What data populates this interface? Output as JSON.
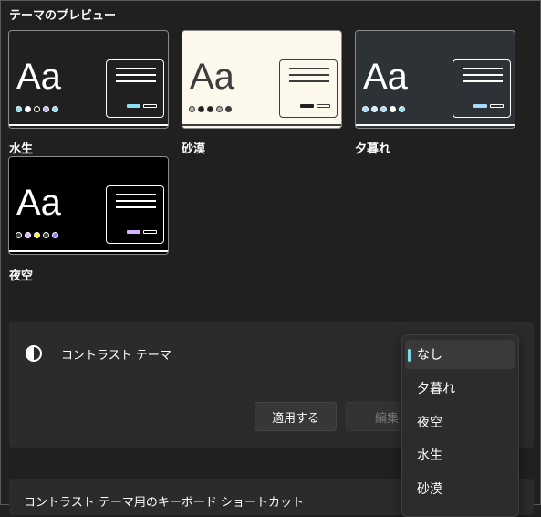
{
  "preview": {
    "title": "テーマのプレビュー"
  },
  "themes": [
    {
      "name": "水生",
      "bg": "#202020",
      "fg": "#ffffff",
      "accent": "#8ae0f0",
      "dots": [
        "#8ae0f0",
        "#ffffff",
        "#1a1a1a",
        "#c0a8f0",
        "#8ae0f0"
      ]
    },
    {
      "name": "砂漠",
      "bg": "#fcf8ec",
      "fg": "#3d3d3d",
      "accent": "#202020",
      "dots": [
        "#b0b0b0",
        "#202020",
        "#202020",
        "#b0b0b0",
        "#3d3d3d"
      ]
    },
    {
      "name": "夕暮れ",
      "bg": "#2d3236",
      "fg": "#ffffff",
      "accent": "#a6d8ff",
      "dots": [
        "#a6d8ff",
        "#d0e8ff",
        "#a6d8ff",
        "#ffffff",
        "#8ae0f0"
      ]
    },
    {
      "name": "夜空",
      "bg": "#000000",
      "fg": "#ffffff",
      "accent": "#d6b4fc",
      "dots": [
        "#3d3d3d",
        "#d6b4fc",
        "#ffee32",
        "#3d3d3d",
        "#8080ff"
      ]
    }
  ],
  "contrast": {
    "label": "コントラスト テーマ",
    "apply_label": "適用する",
    "edit_label": "編集",
    "options": [
      "なし",
      "夕暮れ",
      "夜空",
      "水生",
      "砂漠"
    ],
    "selected": "なし"
  },
  "shortcut": {
    "label": "コントラスト テーマ用のキーボード ショートカット"
  }
}
